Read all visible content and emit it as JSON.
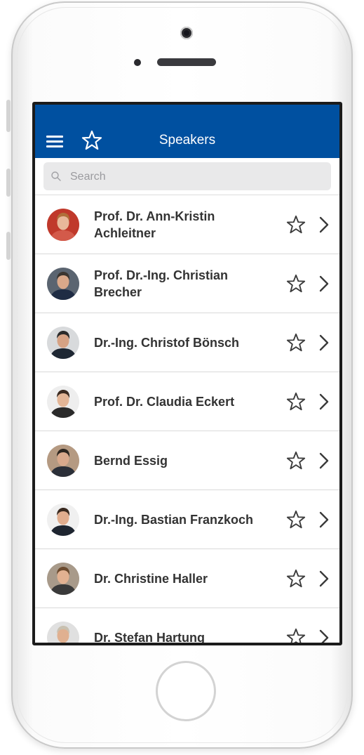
{
  "nav": {
    "title": "Speakers",
    "menu_icon": "hamburger-menu-icon",
    "favorites_icon": "star-outline-icon",
    "bar_color": "#0050a0"
  },
  "search": {
    "placeholder": "Search",
    "value": ""
  },
  "speakers": [
    {
      "name": "Prof. Dr. Ann-Kristin Achleitner",
      "lines": [
        "Prof. Dr. Ann-Kristin",
        "Achleitner"
      ],
      "photo": {
        "bg": "#c0392b",
        "skin": "#e8b89a",
        "hair": "#b0703a",
        "shirt": "#d35a4a"
      }
    },
    {
      "name": "Prof. Dr.-Ing. Christian Brecher",
      "lines": [
        "Prof. Dr.-Ing. Christian",
        "Brecher"
      ],
      "photo": {
        "bg": "#5a6470",
        "skin": "#d9a88a",
        "hair": "#3a3530",
        "shirt": "#1f2c44"
      }
    },
    {
      "name": "Dr.-Ing. Christof Bönsch",
      "lines": [
        "Dr.-Ing. Christof Bönsch"
      ],
      "photo": {
        "bg": "#d8dadc",
        "skin": "#d6a284",
        "hair": "#2b2b2b",
        "shirt": "#1e2733"
      }
    },
    {
      "name": "Prof. Dr. Claudia Eckert",
      "lines": [
        "Prof. Dr. Claudia Eckert"
      ],
      "photo": {
        "bg": "#eeeeee",
        "skin": "#e3b596",
        "hair": "#3b2a20",
        "shirt": "#2a2a2a"
      }
    },
    {
      "name": "Bernd Essig",
      "lines": [
        "Bernd Essig"
      ],
      "photo": {
        "bg": "#b59a82",
        "skin": "#d9a98c",
        "hair": "#2d2620",
        "shirt": "#2b2f38"
      }
    },
    {
      "name": "Dr.-Ing. Bastian Franzkoch",
      "lines": [
        "Dr.-Ing. Bastian Franzkoch"
      ],
      "photo": {
        "bg": "#f0f0f0",
        "skin": "#e0ad8e",
        "hair": "#3a2a20",
        "shirt": "#1e2530"
      }
    },
    {
      "name": "Dr. Christine Haller",
      "lines": [
        "Dr. Christine Haller"
      ],
      "photo": {
        "bg": "#a89a8a",
        "skin": "#e2b191",
        "hair": "#6b4a2e",
        "shirt": "#3a3a3a"
      }
    },
    {
      "name": "Dr. Stefan Hartung",
      "lines": [
        "Dr. Stefan Hartung"
      ],
      "photo": {
        "bg": "#e0e0e0",
        "skin": "#e0b090",
        "hair": "#c8c0b0",
        "shirt": "#2a3040"
      }
    }
  ],
  "row_icons": {
    "favorite": "star-outline-icon",
    "disclosure": "chevron-right-icon"
  }
}
